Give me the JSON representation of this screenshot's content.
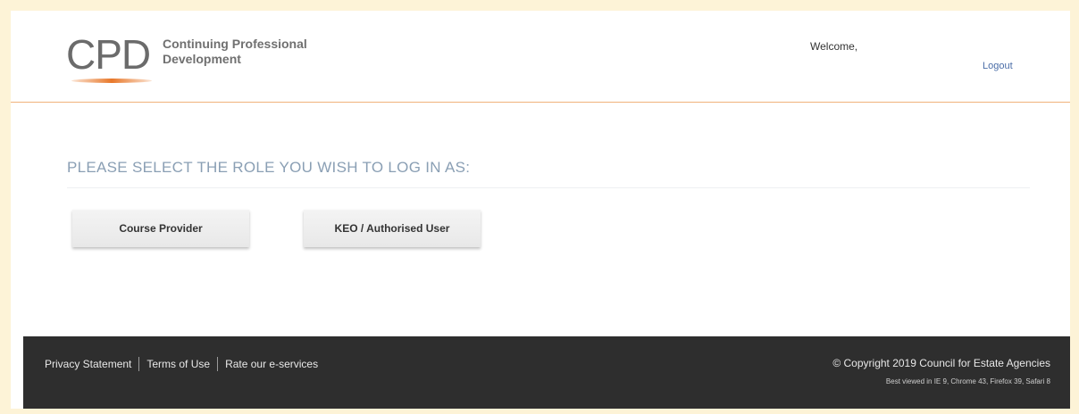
{
  "header": {
    "logo_mark": "CPD",
    "logo_line1": "Continuing Professional",
    "logo_line2": "Development",
    "welcome": "Welcome,",
    "logout": "Logout"
  },
  "main": {
    "title": "PLEASE SELECT THE ROLE YOU WISH TO LOG IN AS:",
    "roles": [
      "Course Provider",
      "KEO / Authorised User"
    ]
  },
  "footer": {
    "links": [
      "Privacy Statement",
      "Terms of Use",
      "Rate our e-services"
    ],
    "copyright": "© Copyright 2019 Council for Estate Agencies",
    "best_viewed": "Best viewed in IE 9, Chrome 43, Firefox 39, Safari 8"
  },
  "colors": {
    "accent": "#e8782a",
    "title": "#8a9fb4",
    "footer_bg": "#2e2e2e",
    "page_border": "#fdf3d7"
  }
}
